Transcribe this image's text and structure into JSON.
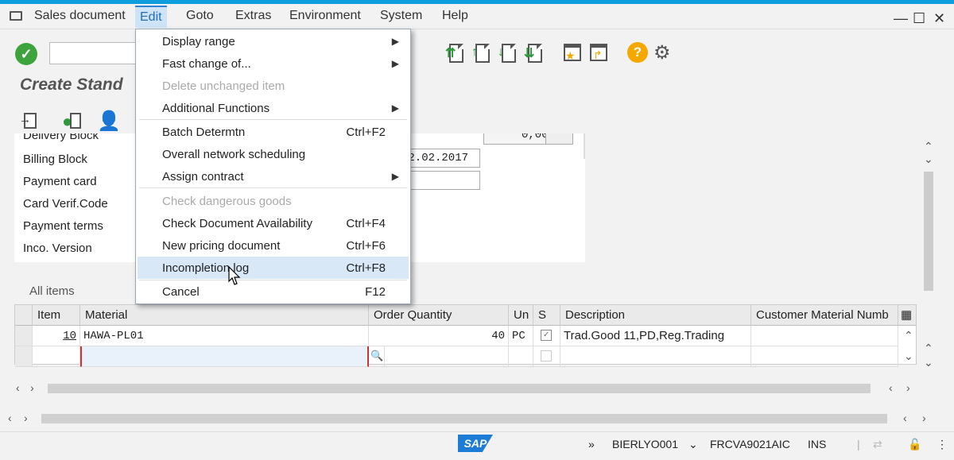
{
  "menubar": {
    "items": [
      "Sales document",
      "Edit",
      "Goto",
      "Extras",
      "Environment",
      "System",
      "Help"
    ],
    "active": "Edit"
  },
  "window_controls": {
    "minimize": "—",
    "maximize": "☐",
    "close": "✕"
  },
  "page_title": "Create Stand",
  "form": {
    "labels": [
      "Delivery Block",
      "Billing Block",
      "Payment card",
      "Card Verif.Code",
      "Payment terms",
      "Inco. Version"
    ],
    "delivery_block_value": "0,000",
    "date_value": "22.02.2017"
  },
  "dropdown": {
    "items": [
      {
        "label": "Display range",
        "shortcut": "",
        "submenu": true,
        "disabled": false
      },
      {
        "label": "Fast change of...",
        "shortcut": "",
        "submenu": true,
        "disabled": false
      },
      {
        "label": "Delete unchanged item",
        "shortcut": "",
        "submenu": false,
        "disabled": true
      },
      {
        "label": "Additional Functions",
        "shortcut": "",
        "submenu": true,
        "disabled": false
      },
      {
        "label": "Batch Determtn",
        "shortcut": "Ctrl+F2",
        "submenu": false,
        "disabled": false
      },
      {
        "label": "Overall network scheduling",
        "shortcut": "",
        "submenu": false,
        "disabled": false
      },
      {
        "label": "Assign contract",
        "shortcut": "",
        "submenu": true,
        "disabled": false
      },
      {
        "label": "Check dangerous goods",
        "shortcut": "",
        "submenu": false,
        "disabled": true
      },
      {
        "label": "Check Document Availability",
        "shortcut": "Ctrl+F4",
        "submenu": false,
        "disabled": false
      },
      {
        "label": "New pricing document",
        "shortcut": "Ctrl+F6",
        "submenu": false,
        "disabled": false
      },
      {
        "label": "Incompletion log",
        "shortcut": "Ctrl+F8",
        "submenu": false,
        "disabled": false,
        "highlighted": true
      },
      {
        "label": "Cancel",
        "shortcut": "F12",
        "submenu": false,
        "disabled": false
      }
    ]
  },
  "items_section": {
    "title": "All items",
    "columns": [
      "Item",
      "Material",
      "Order Quantity",
      "Un",
      "S",
      "Description",
      "Customer Material Numb"
    ],
    "rows": [
      {
        "item": "10",
        "material": "HAWA-PL01",
        "qty": "40",
        "unit": "PC",
        "s": "✓",
        "description": "Trad.Good 11,PD,Reg.Trading",
        "cust": ""
      }
    ]
  },
  "statusbar": {
    "logo": "SAP",
    "user": "BIERLYO001",
    "server": "FRCVA9021AIC",
    "mode": "INS",
    "chevrons": "»"
  },
  "colors": {
    "accent": "#0e9ddd",
    "ok": "#3ca33d",
    "help": "#f4a800",
    "menu_highlight": "#d9e8f6"
  }
}
